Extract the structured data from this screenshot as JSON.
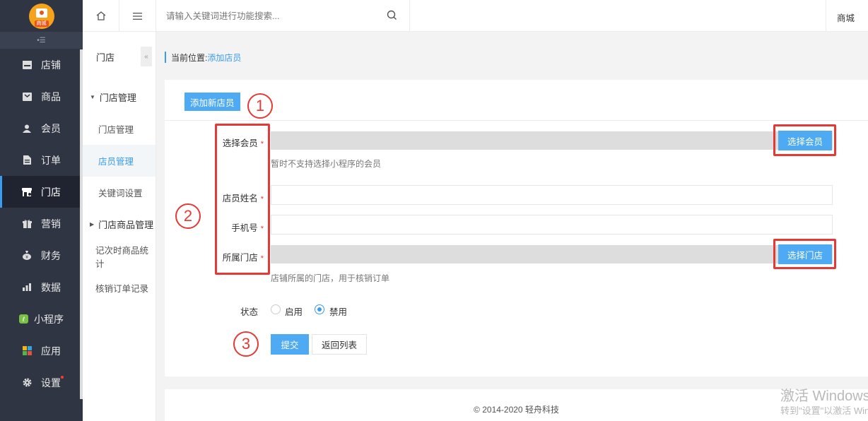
{
  "sidebar": {
    "logo_text": "商城",
    "items": [
      {
        "label": "店铺",
        "icon": "store-icon"
      },
      {
        "label": "商品",
        "icon": "goods-icon"
      },
      {
        "label": "会员",
        "icon": "user-icon"
      },
      {
        "label": "订单",
        "icon": "order-icon"
      },
      {
        "label": "门店",
        "icon": "shop-icon",
        "active": true
      },
      {
        "label": "营销",
        "icon": "gift-icon"
      },
      {
        "label": "财务",
        "icon": "money-bag-icon"
      },
      {
        "label": "数据",
        "icon": "chart-icon"
      },
      {
        "label": "小程序",
        "icon": "miniapp-icon"
      },
      {
        "label": "应用",
        "icon": "apps-icon"
      },
      {
        "label": "设置",
        "icon": "gear-icon"
      }
    ]
  },
  "subsidebar": {
    "title": "门店",
    "group1": "门店管理",
    "items1": [
      "门店管理",
      "店员管理",
      "关键词设置"
    ],
    "group2": "门店商品管理",
    "items2": [
      "记次时商品统计",
      "核销订单记录"
    ]
  },
  "topbar": {
    "search_placeholder": "请输入关键词进行功能搜索...",
    "right_text": "商城"
  },
  "breadcrumb": {
    "prefix": "当前位置:",
    "current": "添加店员"
  },
  "form": {
    "add_button": "添加新店员",
    "member_label": "选择会员",
    "member_button": "选择会员",
    "member_hint": "暂时不支持选择小程序的会员",
    "name_label": "店员姓名",
    "phone_label": "手机号",
    "store_label": "所属门店",
    "store_button": "选择门店",
    "store_hint": "店铺所属的门店，用于核销订单",
    "status_label": "状态",
    "status_options": [
      "启用",
      "禁用"
    ],
    "status_selected": "禁用",
    "submit": "提交",
    "back": "返回列表",
    "required_mark": "*"
  },
  "annotations": [
    "1",
    "2",
    "3"
  ],
  "footer": "© 2014-2020 轻舟科技",
  "watermark": {
    "line1": "激活 Windows",
    "line2": "转到\"设置\"以激活 Windows。"
  },
  "colors": {
    "accent": "#3a9cf0",
    "button_blue": "#4eaaf2",
    "sidebar_bg": "#2f3542",
    "annotation_red": "#e53935"
  }
}
